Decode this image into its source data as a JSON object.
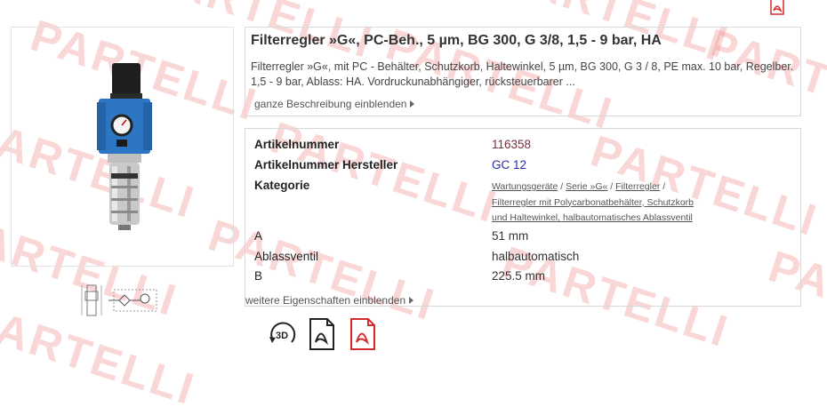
{
  "product": {
    "title": "Filterregler »G«, PC-Beh., 5 µm, BG 300, G 3/8, 1,5 - 9 bar, HA",
    "description": "Filterregler »G«, mit PC - Behälter, Schutzkorb, Haltewinkel, 5 µm, BG 300, G 3 / 8, PE max. 10 bar, Regelber. 1,5 - 9 bar, Ablass: HA. Vordruckunabhängiger, rücksteuerbarer ...",
    "show_description_label": "ganze Beschreibung einblenden"
  },
  "properties": [
    {
      "label": "Artikelnummer",
      "value": "116358"
    },
    {
      "label": "Artikelnummer Hersteller",
      "value": "GC 12"
    },
    {
      "label": "Kategorie",
      "value": ""
    },
    {
      "label": "A",
      "value": "51 mm"
    },
    {
      "label": "Ablassventil",
      "value": "halbautomatisch"
    },
    {
      "label": "B",
      "value": "225.5 mm"
    }
  ],
  "category_links": {
    "l1": "Wartungsgeräte",
    "l2": "Serie »G«",
    "l3": "Filterregler",
    "l4": "Filterregler mit Polycarbonatbehälter, Schutzkorb und Haltewinkel, halbautomatisches Ablassventil",
    "separator": " / "
  },
  "more_properties_label": "weitere Eigenschaften einblenden",
  "icons": {
    "three_d_label": "3D",
    "pdf_accent": "#d42b2b"
  },
  "watermark": {
    "text": "PARTELLI",
    "color": "#f08282"
  }
}
